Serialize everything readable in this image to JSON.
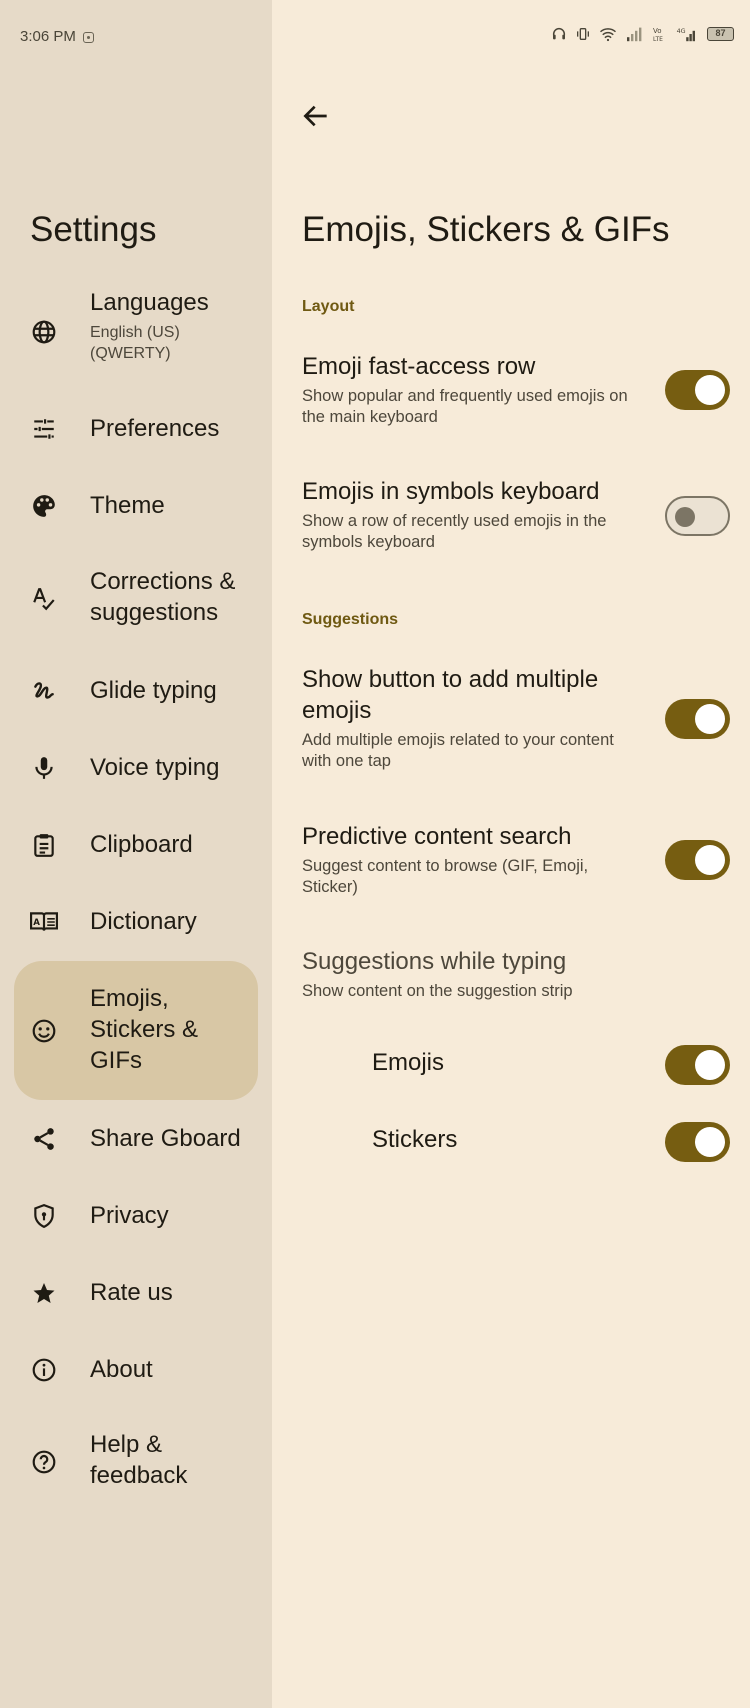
{
  "status_bar": {
    "time": "3:06 PM",
    "battery": "87"
  },
  "sidebar": {
    "title": "Settings",
    "items": [
      {
        "label": "Languages",
        "sub": "English (US) (QWERTY)",
        "icon": "globe-icon"
      },
      {
        "label": "Preferences",
        "icon": "sliders-icon"
      },
      {
        "label": "Theme",
        "icon": "palette-icon"
      },
      {
        "label": "Corrections & suggestions",
        "icon": "spellcheck-icon"
      },
      {
        "label": "Glide typing",
        "icon": "gesture-icon"
      },
      {
        "label": "Voice typing",
        "icon": "microphone-icon"
      },
      {
        "label": "Clipboard",
        "icon": "clipboard-icon"
      },
      {
        "label": "Dictionary",
        "icon": "dictionary-icon"
      },
      {
        "label": "Emojis, Stickers & GIFs",
        "icon": "smiley-icon",
        "active": true
      },
      {
        "label": "Share Gboard",
        "icon": "share-icon"
      },
      {
        "label": "Privacy",
        "icon": "shield-icon"
      },
      {
        "label": "Rate us",
        "icon": "star-icon"
      },
      {
        "label": "About",
        "icon": "info-icon"
      },
      {
        "label": "Help & feedback",
        "icon": "help-icon"
      }
    ]
  },
  "main": {
    "title": "Emojis, Stickers & GIFs",
    "sections": {
      "layout": "Layout",
      "suggestions": "Suggestions"
    },
    "settings": {
      "emoji_row": {
        "title": "Emoji fast-access row",
        "desc": "Show popular and frequently used emojis on the main keyboard",
        "enabled": true
      },
      "emojis_symbols": {
        "title": "Emojis in symbols keyboard",
        "desc": "Show a row of recently used emojis in the symbols keyboard",
        "enabled": false
      },
      "add_multiple": {
        "title": "Show button to add multiple emojis",
        "desc": "Add multiple emojis related to your content with one tap",
        "enabled": true
      },
      "predictive": {
        "title": "Predictive content search",
        "desc": "Suggest content to browse (GIF, Emoji, Sticker)",
        "enabled": true
      },
      "while_typing": {
        "title": "Suggestions while typing",
        "desc": "Show content on the suggestion strip"
      },
      "sub_emojis": {
        "title": "Emojis",
        "enabled": true
      },
      "sub_stickers": {
        "title": "Stickers",
        "enabled": true
      }
    }
  },
  "colors": {
    "accent": "#765d11",
    "sidebar_bg": "#e6dac8",
    "active_bg": "#d8c7a5",
    "page_bg": "#f7ebd9"
  }
}
